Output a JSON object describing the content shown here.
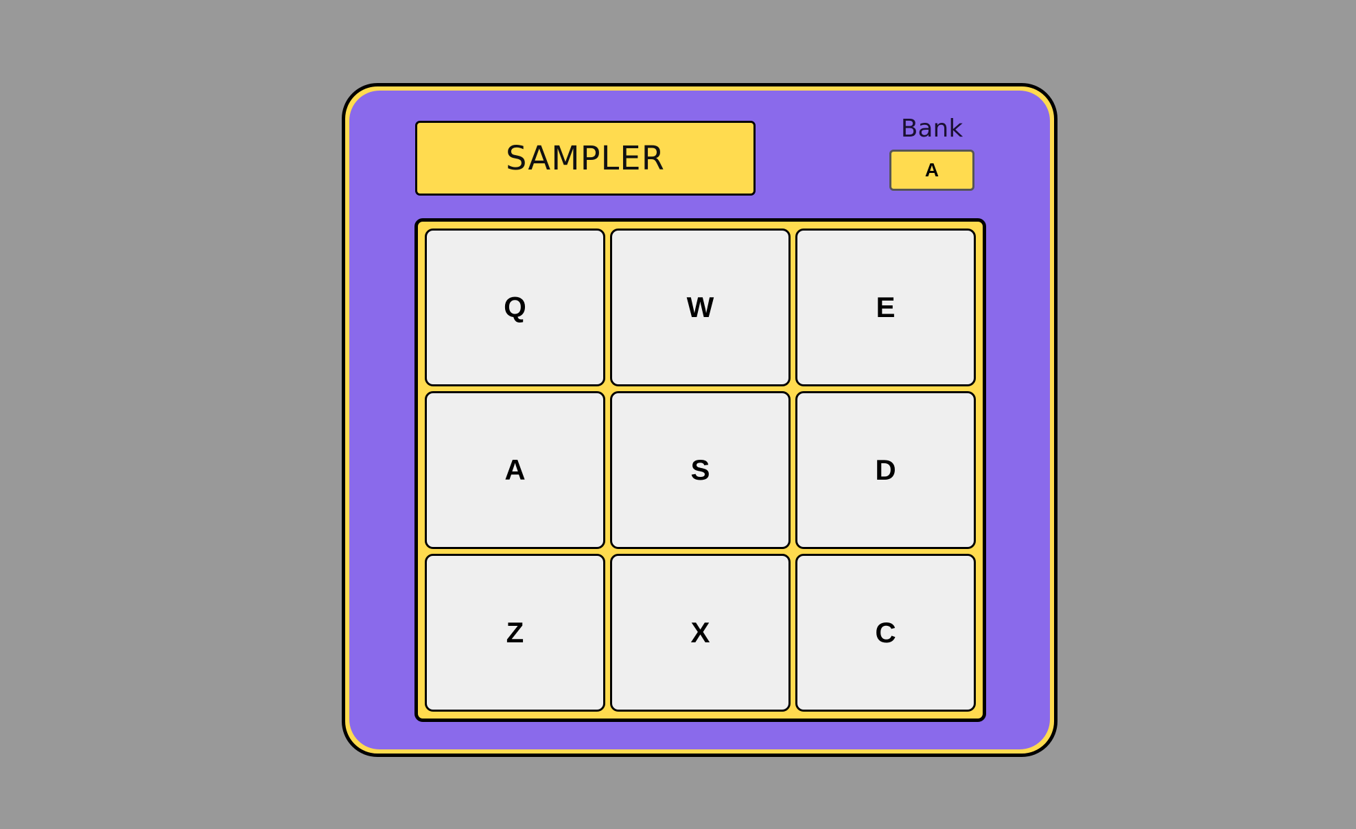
{
  "app": {
    "title": "SAMPLER"
  },
  "bank": {
    "label": "Bank",
    "value": "A"
  },
  "pads": [
    "Q",
    "W",
    "E",
    "A",
    "S",
    "D",
    "Z",
    "X",
    "C"
  ],
  "colors": {
    "background": "#999999",
    "device_body": "#8A6AEB",
    "accent_yellow": "#FFDB4F",
    "pad": "#EFEFEF",
    "outline": "#000000"
  }
}
